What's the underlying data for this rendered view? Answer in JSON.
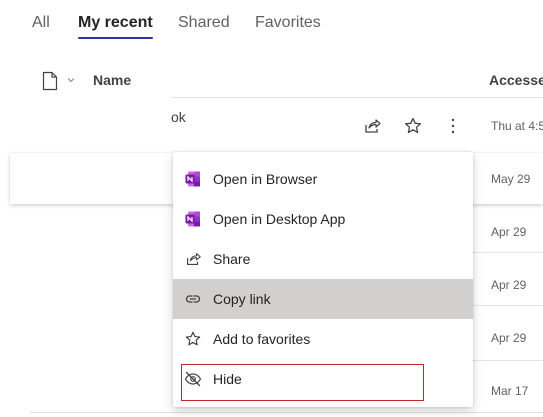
{
  "tabs": [
    {
      "label": "All",
      "active": false
    },
    {
      "label": "My recent",
      "active": true
    },
    {
      "label": "Shared",
      "active": false
    },
    {
      "label": "Favorites",
      "active": false
    }
  ],
  "columns": {
    "name": "Name",
    "accessed": "Accessed"
  },
  "rows": [
    {
      "name_fragment": "ok",
      "accessed": "Thu at 4:5"
    },
    {
      "accessed": "May 29"
    },
    {
      "accessed": "Apr 29"
    },
    {
      "accessed": "Apr 29"
    },
    {
      "accessed": "Apr 29"
    },
    {
      "accessed": "Mar 17"
    }
  ],
  "row_actions": {
    "share_icon": "share-icon",
    "favorite_icon": "star-icon",
    "more_icon": "more-vertical-icon"
  },
  "context_menu": {
    "items": [
      {
        "label": "Open in Browser",
        "icon": "onenote-icon"
      },
      {
        "label": "Open in Desktop App",
        "icon": "onenote-icon"
      },
      {
        "label": "Share",
        "icon": "share-icon"
      },
      {
        "label": "Copy link",
        "icon": "link-icon",
        "hover": true
      },
      {
        "label": "Add to favorites",
        "icon": "star-icon"
      },
      {
        "label": "Hide",
        "icon": "hide-icon",
        "highlighted": true
      }
    ]
  },
  "colors": {
    "accent": "#2b32b2",
    "onenote": "#7719aa",
    "hover_bg": "#d2d0ce",
    "highlight_border": "#c4262e"
  }
}
